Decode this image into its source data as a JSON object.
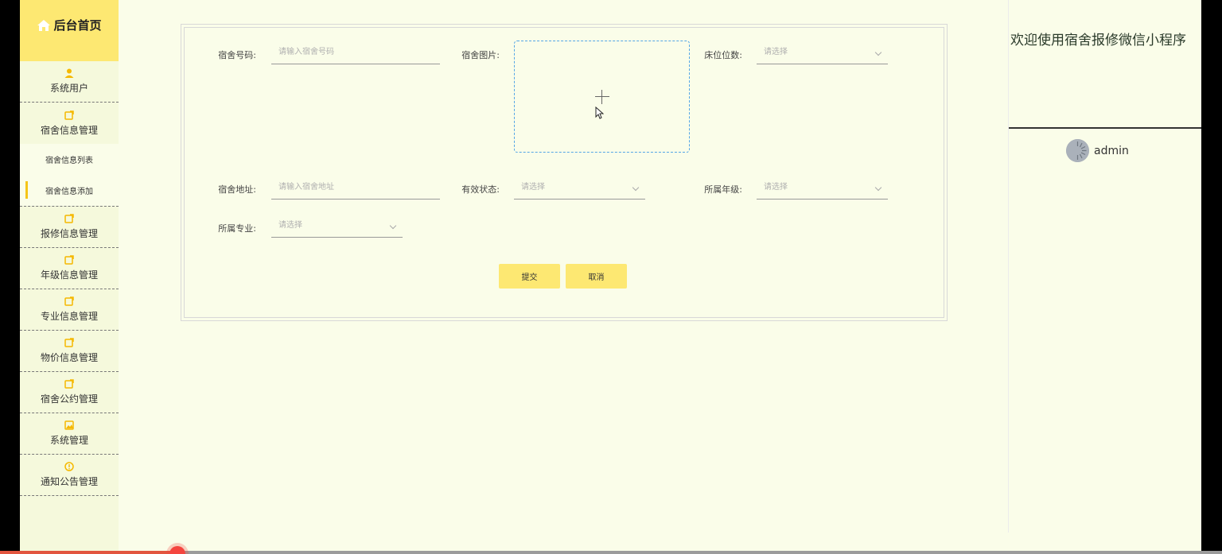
{
  "sidebar": {
    "home_label": "后台首页",
    "items": [
      {
        "label": "系统用户",
        "icon": "user-icon"
      },
      {
        "label": "宿舍信息管理",
        "icon": "edit-icon"
      },
      {
        "label": "报修信息管理",
        "icon": "edit-icon"
      },
      {
        "label": "年级信息管理",
        "icon": "edit-icon"
      },
      {
        "label": "专业信息管理",
        "icon": "edit-icon"
      },
      {
        "label": "物价信息管理",
        "icon": "edit-icon"
      },
      {
        "label": "宿舍公约管理",
        "icon": "edit-icon"
      },
      {
        "label": "系统管理",
        "icon": "image-icon"
      },
      {
        "label": "通知公告管理",
        "icon": "info-icon"
      }
    ],
    "subitems": [
      {
        "label": "宿舍信息列表",
        "active": false
      },
      {
        "label": "宿舍信息添加",
        "active": true
      }
    ]
  },
  "form": {
    "dorm_number": {
      "label": "宿舍号码:",
      "placeholder": "请输入宿舍号码"
    },
    "dorm_image": {
      "label": "宿舍图片:"
    },
    "bed_count": {
      "label": "床位位数:",
      "placeholder": "请选择"
    },
    "dorm_address": {
      "label": "宿舍地址:",
      "placeholder": "请输入宿舍地址"
    },
    "valid_status": {
      "label": "有效状态:",
      "placeholder": "请选择"
    },
    "grade": {
      "label": "所属年级:",
      "placeholder": "请选择"
    },
    "major": {
      "label": "所属专业:",
      "placeholder": "请选择"
    },
    "submit_label": "提交",
    "cancel_label": "取消"
  },
  "header": {
    "welcome": "欢迎使用宿舍报修微信小程序",
    "username": "admin"
  },
  "colors": {
    "accent": "#fde872",
    "background": "#fafde9",
    "icon": "#f5b800",
    "uploader_border": "#54a6e6"
  }
}
